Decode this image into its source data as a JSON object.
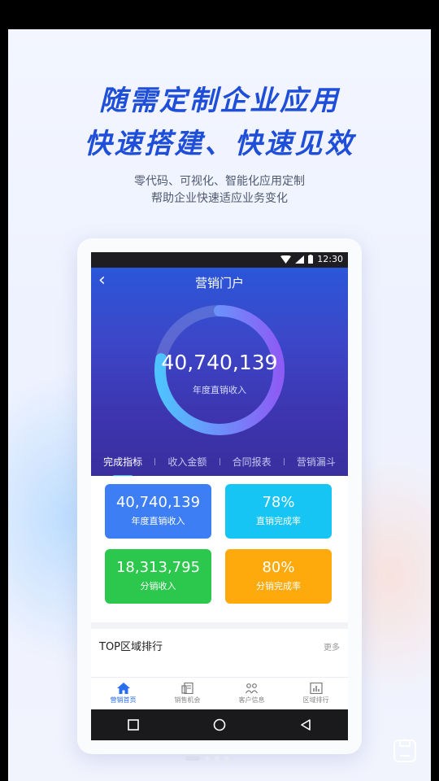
{
  "hero_text": {
    "headline_1": "随需定制企业应用",
    "headline_2": "快速搭建、快速见效",
    "subline_1": "零代码、可视化、智能化应用定制",
    "subline_2": "帮助企业快速适应业务变化"
  },
  "statusbar": {
    "time": "12:30"
  },
  "app": {
    "title": "营销门户",
    "ring": {
      "value": "40,740,139",
      "label": "年度直销收入",
      "progress": 0.78
    },
    "tabs": [
      "完成指标",
      "收入金额",
      "合同报表",
      "营销漏斗"
    ],
    "kpis": [
      {
        "value": "40,740,139",
        "label": "年度直销收入",
        "color": "#3d7ef5"
      },
      {
        "value": "78%",
        "label": "直销完成率",
        "color": "#16c5f4"
      },
      {
        "value": "18,313,795",
        "label": "分销收入",
        "color": "#2cc84d"
      },
      {
        "value": "80%",
        "label": "分销完成率",
        "color": "#ffaa0c"
      }
    ],
    "top_section": {
      "title": "TOP区域排行",
      "more": "更多"
    },
    "bottom_nav": [
      {
        "label": "营销首页",
        "icon": "home-icon",
        "active": true
      },
      {
        "label": "销售机会",
        "icon": "document-icon",
        "active": false
      },
      {
        "label": "客户信息",
        "icon": "people-icon",
        "active": false
      },
      {
        "label": "区域排行",
        "icon": "chart-icon",
        "active": false
      }
    ]
  },
  "colors": {
    "headline": "#1f4fd9",
    "accent": "#2ec4ff",
    "nav_active": "#2a6ef0"
  }
}
